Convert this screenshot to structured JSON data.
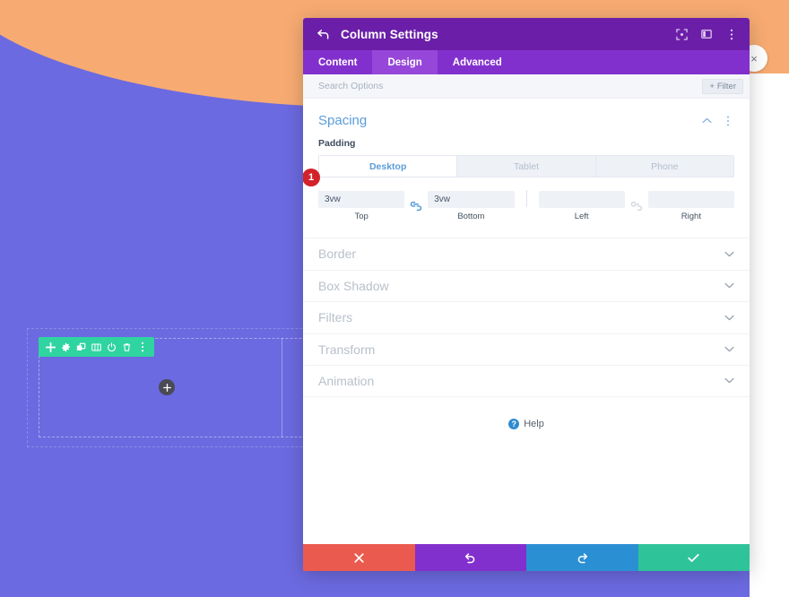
{
  "canvas": {
    "module_toolbar": {
      "icons": [
        {
          "name": "add-icon",
          "label": "Add"
        },
        {
          "name": "gear-icon",
          "label": "Settings"
        },
        {
          "name": "duplicate-icon",
          "label": "Duplicate"
        },
        {
          "name": "columns-icon",
          "label": "Change Column Structure"
        },
        {
          "name": "power-icon",
          "label": "Disable"
        },
        {
          "name": "trash-icon",
          "label": "Delete"
        },
        {
          "name": "kebab-icon",
          "label": "More Options"
        }
      ]
    },
    "add_module_button_label": "+",
    "side_circle_label": "×"
  },
  "modal": {
    "title": "Column Settings",
    "back_icon": "back-arrow-icon",
    "titlebar_icons": [
      {
        "name": "expand-icon"
      },
      {
        "name": "panel-layout-icon"
      },
      {
        "name": "kebab-icon"
      }
    ],
    "tabs": [
      {
        "label": "Content",
        "active": false
      },
      {
        "label": "Design",
        "active": true
      },
      {
        "label": "Advanced",
        "active": false
      }
    ],
    "search": {
      "placeholder": "Search Options",
      "value": ""
    },
    "filter_button_label": "Filter",
    "spacing": {
      "title": "Spacing",
      "field_label": "Padding",
      "device_tabs": [
        {
          "label": "Desktop",
          "active": true
        },
        {
          "label": "Tablet",
          "active": false
        },
        {
          "label": "Phone",
          "active": false
        }
      ],
      "badge": "1",
      "fields": [
        {
          "caption": "Top",
          "value": "3vw",
          "placeholder": ""
        },
        {
          "caption": "Bottom",
          "value": "3vw",
          "placeholder": ""
        },
        {
          "caption": "Left",
          "value": "",
          "placeholder": ""
        },
        {
          "caption": "Right",
          "value": "",
          "placeholder": ""
        }
      ]
    },
    "collapsed_sections": [
      {
        "label": "Border"
      },
      {
        "label": "Box Shadow"
      },
      {
        "label": "Filters"
      },
      {
        "label": "Transform"
      },
      {
        "label": "Animation"
      }
    ],
    "help": {
      "label": "Help",
      "icon": "question-mark-icon"
    },
    "footer_buttons": [
      {
        "name": "cancel-button",
        "icon": "close-icon",
        "color": "#ea5a4f"
      },
      {
        "name": "undo-button",
        "icon": "undo-icon",
        "color": "#8230cd"
      },
      {
        "name": "redo-button",
        "icon": "redo-icon",
        "color": "#2b8fd4"
      },
      {
        "name": "save-button",
        "icon": "check-icon",
        "color": "#2fc39a"
      }
    ]
  },
  "colors": {
    "background_purple": "#6c6ae0",
    "accent_orange": "#f7ab72",
    "modal_header": "#6b1fa8",
    "modal_tabs": "#8230cd",
    "section_blue": "#5b9dd9",
    "toolbar_green": "#2fd4a0",
    "badge_red": "#d2232a"
  }
}
